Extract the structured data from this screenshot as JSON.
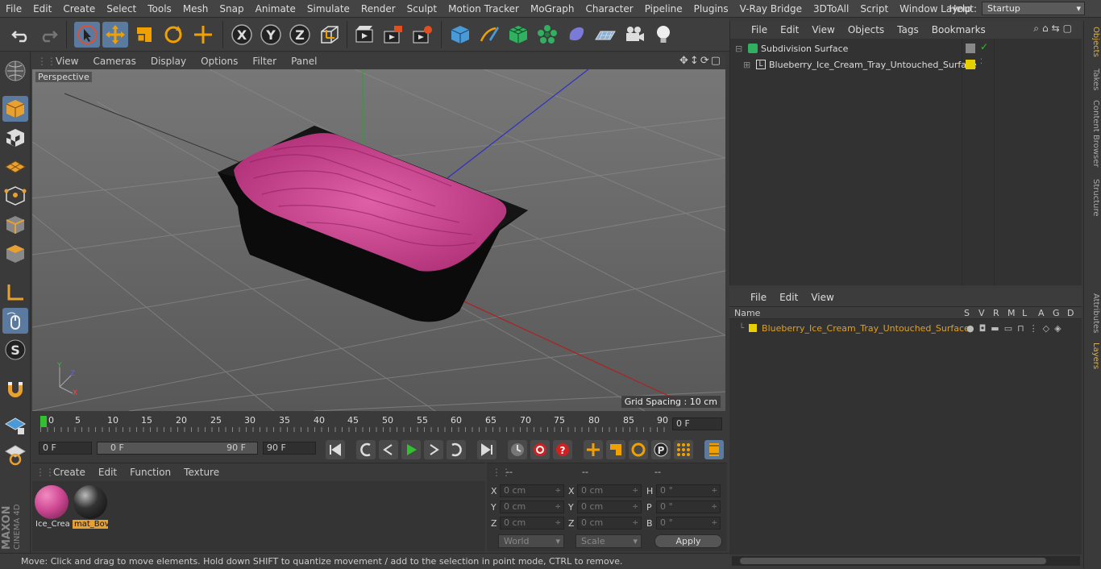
{
  "menubar": {
    "items": [
      "File",
      "Edit",
      "Create",
      "Select",
      "Tools",
      "Mesh",
      "Snap",
      "Animate",
      "Simulate",
      "Render",
      "Sculpt",
      "Motion Tracker",
      "MoGraph",
      "Character",
      "Pipeline",
      "Plugins",
      "V-Ray Bridge",
      "3DToAll",
      "Script",
      "Window",
      "Help"
    ],
    "layout_label": "Layout:",
    "layout_value": "Startup"
  },
  "toolbar": {
    "icons": [
      "undo-icon",
      "redo-icon",
      "select-cursor-icon",
      "move-icon",
      "scale-icon",
      "rotate-icon",
      "move-plus-icon",
      "x-axis-icon",
      "y-axis-icon",
      "z-axis-icon",
      "coord-system-icon",
      "render-view-icon",
      "render-picture-queue-icon",
      "render-settings-icon",
      "cube-icon",
      "pen-icon",
      "subdivision-icon",
      "cloner-icon",
      "deformer-icon",
      "floor-icon",
      "camera-icon",
      "light-icon"
    ],
    "axis_x": "X",
    "axis_y": "Y",
    "axis_z": "Z"
  },
  "viewport": {
    "menu": [
      "View",
      "Cameras",
      "Display",
      "Options",
      "Filter",
      "Panel"
    ],
    "label": "Perspective",
    "grid_spacing": "Grid Spacing : 10 cm"
  },
  "timeline": {
    "ticks": [
      "0",
      "5",
      "10",
      "15",
      "20",
      "25",
      "30",
      "35",
      "40",
      "45",
      "50",
      "55",
      "60",
      "65",
      "70",
      "75",
      "80",
      "85",
      "90"
    ],
    "current_frame": "0 F"
  },
  "playbar": {
    "start": "0 F",
    "range_start": "0 F",
    "range_end": "90 F",
    "end": "90 F"
  },
  "materials": {
    "menu": [
      "Create",
      "Edit",
      "Function",
      "Texture"
    ],
    "items": [
      {
        "label": "Ice_Crea",
        "color": "#d04a95"
      },
      {
        "label": "mat_Bov",
        "color": "#222222"
      }
    ]
  },
  "coords": {
    "headers": [
      "--",
      "--",
      "--"
    ],
    "rows": [
      {
        "a": "X",
        "av": "0 cm",
        "b": "X",
        "bv": "0 cm",
        "c": "H",
        "cv": "0 °"
      },
      {
        "a": "Y",
        "av": "0 cm",
        "b": "Y",
        "bv": "0 cm",
        "c": "P",
        "cv": "0 °"
      },
      {
        "a": "Z",
        "av": "0 cm",
        "b": "Z",
        "bv": "0 cm",
        "c": "B",
        "cv": "0 °"
      }
    ],
    "mode1": "World",
    "mode2": "Scale",
    "apply": "Apply"
  },
  "status": "Move: Click and drag to move elements. Hold down SHIFT to quantize movement / add to the selection in point mode, CTRL to remove.",
  "objects": {
    "menu": [
      "File",
      "Edit",
      "View",
      "Objects",
      "Tags",
      "Bookmarks"
    ],
    "items": [
      {
        "name": "Subdivision Surface"
      },
      {
        "name": "Blueberry_Ice_Cream_Tray_Untouched_Surface"
      }
    ]
  },
  "layers": {
    "menu": [
      "File",
      "Edit",
      "View"
    ],
    "name_header": "Name",
    "cols": [
      "S",
      "V",
      "R",
      "M",
      "L",
      "A",
      "G",
      "D"
    ],
    "items": [
      {
        "name": "Blueberry_Ice_Cream_Tray_Untouched_Surface",
        "color": "#e6d000"
      }
    ]
  },
  "righttabs": [
    "Objects",
    "Takes",
    "Content Browser",
    "Structure",
    "Attributes",
    "Layers"
  ],
  "brand": {
    "line1": "MAXON",
    "line2": "CINEMA 4D"
  },
  "colors": {
    "accent": "#e0b040",
    "layer_text": "#e0a020",
    "selected_bg": "#5b7aa0"
  }
}
